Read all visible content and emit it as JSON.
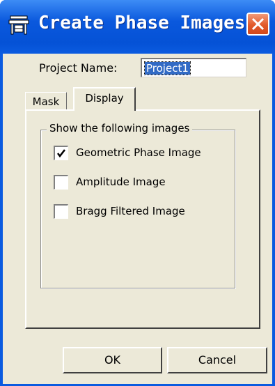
{
  "window": {
    "title": "Create Phase Images",
    "app_icon": "dialog-app-icon",
    "close_icon": "close-icon",
    "titlebar_color": "#0b5be0",
    "close_color": "#e25a2a"
  },
  "project": {
    "label": "Project Name:",
    "value": "Project1"
  },
  "tabs": [
    {
      "label": "Mask",
      "active": false
    },
    {
      "label": "Display",
      "active": true
    }
  ],
  "display_panel": {
    "group_label": "Show the following images",
    "options": [
      {
        "label": "Geometric Phase Image",
        "checked": true
      },
      {
        "label": "Amplitude Image",
        "checked": false
      },
      {
        "label": "Bragg Filtered Image",
        "checked": false
      }
    ]
  },
  "buttons": {
    "ok_label": "OK",
    "cancel_label": "Cancel"
  }
}
